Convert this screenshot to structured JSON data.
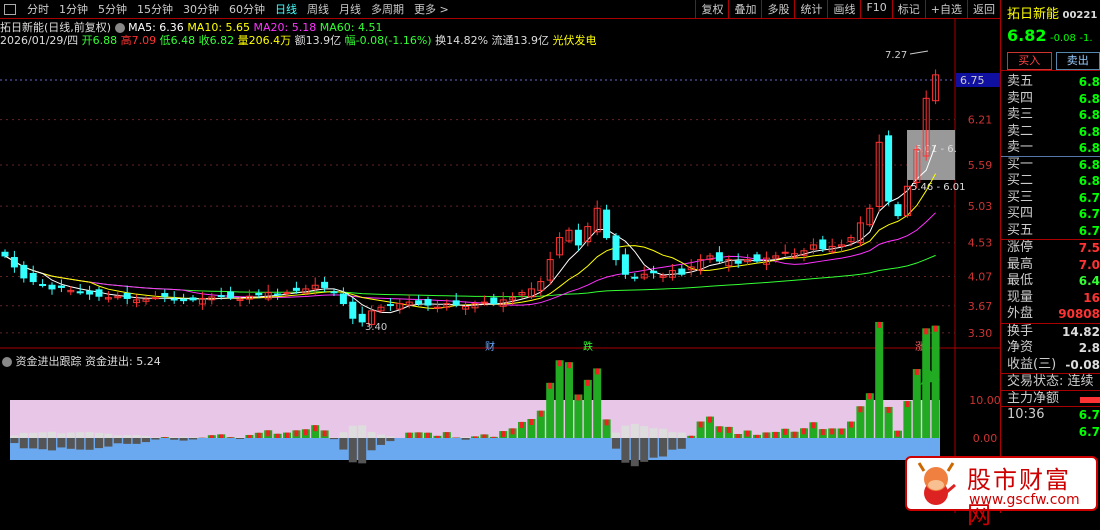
{
  "toolbar": {
    "tabs": [
      "分时",
      "1分钟",
      "5分钟",
      "15分钟",
      "30分钟",
      "60分钟",
      "日线",
      "周线",
      "月线",
      "多周期",
      "更多 >"
    ],
    "active": "日线",
    "buttons": [
      "复权",
      "叠加",
      "多股",
      "统计",
      "画线",
      "F10",
      "标记",
      "+自选",
      "返回"
    ]
  },
  "header": {
    "title": "拓日新能(日线,前复权)",
    "ma5": "MA5: 6.36",
    "ma10": "MA10: 5.65",
    "ma20": "MA20: 5.18",
    "ma60": "MA60: 4.51",
    "date": "2026/01/29/四",
    "open": "开6.88",
    "high": "高7.09",
    "low": "低6.48",
    "close": "收6.82",
    "vol": "量206.4万",
    "amount": "额13.9亿",
    "change": "幅-0.08(-1.16%)",
    "turnover": "换14.82%",
    "float": "流通13.9亿",
    "sector": "光伏发电"
  },
  "colors": {
    "up": "#ff3333",
    "down": "#33ffff",
    "ma5": "#ffffff",
    "ma10": "#ffff00",
    "ma20": "#ff33ff",
    "ma60": "#33ff33",
    "axis": "#cc3333"
  },
  "chart_data": {
    "type": "candlestick",
    "closes": [
      4.35,
      4.2,
      4.05,
      4.0,
      3.95,
      3.9,
      3.92,
      3.88,
      3.85,
      3.83,
      3.8,
      3.78,
      3.8,
      3.77,
      3.75,
      3.76,
      3.78,
      3.8,
      3.76,
      3.74,
      3.75,
      3.77,
      3.79,
      3.8,
      3.78,
      3.76,
      3.8,
      3.82,
      3.85,
      3.83,
      3.85,
      3.88,
      3.9,
      3.95,
      3.92,
      3.85,
      3.7,
      3.5,
      3.45,
      3.6,
      3.65,
      3.68,
      3.7,
      3.72,
      3.7,
      3.68,
      3.65,
      3.7,
      3.68,
      3.66,
      3.7,
      3.72,
      3.7,
      3.75,
      3.78,
      3.85,
      3.9,
      4.0,
      4.3,
      4.6,
      4.7,
      4.5,
      4.75,
      5.0,
      4.6,
      4.3,
      4.1,
      4.05,
      4.1,
      4.12,
      4.08,
      4.15,
      4.1,
      4.2,
      4.3,
      4.35,
      4.28,
      4.3,
      4.25,
      4.3,
      4.28,
      4.32,
      4.35,
      4.4,
      4.38,
      4.42,
      4.5,
      4.45,
      4.48,
      4.5,
      4.6,
      4.8,
      5.0,
      5.9,
      5.1,
      4.9,
      5.3,
      5.8,
      6.5,
      6.82
    ],
    "y_ticks": [
      "6.21",
      "5.59",
      "5.03",
      "4.53",
      "4.07",
      "3.67",
      "3.30"
    ],
    "current_price_tag": "6.75",
    "high_label": "7.27",
    "low_label": "3.40",
    "range_labels": [
      "6.01 - 6.",
      "5.46 - 6.01"
    ],
    "markers": [
      "财",
      "跌",
      "涨"
    ],
    "indicator": {
      "title": "资金进出跟踪",
      "value_label": "资金进出: 5.24",
      "y_ticks": [
        "10.00",
        "0.00"
      ]
    }
  },
  "quote": {
    "name": "拓日新能",
    "code": "00221",
    "price": "6.82",
    "change": "-0.08",
    "pct": "-1.",
    "buy": "买入",
    "sell": "卖出",
    "book": [
      [
        "卖五",
        "6.8"
      ],
      [
        "卖四",
        "6.8"
      ],
      [
        "卖三",
        "6.8"
      ],
      [
        "卖二",
        "6.8"
      ],
      [
        "卖一",
        "6.8"
      ],
      [
        "买一",
        "6.8"
      ],
      [
        "买二",
        "6.8"
      ],
      [
        "买三",
        "6.7"
      ],
      [
        "买四",
        "6.7"
      ],
      [
        "买五",
        "6.7"
      ]
    ],
    "stats": [
      [
        "涨停",
        "7.5",
        "#ff3333"
      ],
      [
        "最高",
        "7.0",
        "#ff3333"
      ],
      [
        "最低",
        "6.4",
        "#33ff33"
      ],
      [
        "现量",
        "16",
        "#ff3333"
      ],
      [
        "外盘",
        "90808",
        "#ff3333"
      ]
    ],
    "stats2": [
      [
        "换手",
        "14.82"
      ],
      [
        "净资",
        "2.8"
      ],
      [
        "收益(三)",
        "-0.08"
      ]
    ],
    "status": "交易状态: 连续",
    "main_net": "主力净额",
    "ticks": [
      [
        "10:36",
        "6.7"
      ],
      [
        "",
        "6.7"
      ]
    ]
  },
  "watermark": {
    "name": "股市财富网",
    "url": "www.gscfw.com"
  }
}
